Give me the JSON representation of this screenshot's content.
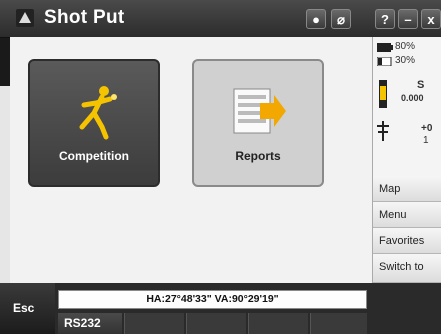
{
  "titlebar": {
    "title": "Shot Put",
    "buttons": [
      "?",
      "x"
    ]
  },
  "main": {
    "buttons": [
      {
        "label": "Competition",
        "icon": "athlete-throwing-icon"
      },
      {
        "label": "Reports",
        "icon": "report-export-icon"
      }
    ]
  },
  "status": {
    "battery1": "80%",
    "battery2": "30%",
    "item_s": "S",
    "item_val": "0.000",
    "item_plus": "+0",
    "item_one": "1"
  },
  "side_menu": {
    "items": [
      "Map",
      "Menu",
      "Favorites",
      "Switch to"
    ]
  },
  "bottom": {
    "esc_label": "Esc",
    "angles": "HA:27°48'33\" VA:90°29'19\"",
    "port": "RS232"
  }
}
